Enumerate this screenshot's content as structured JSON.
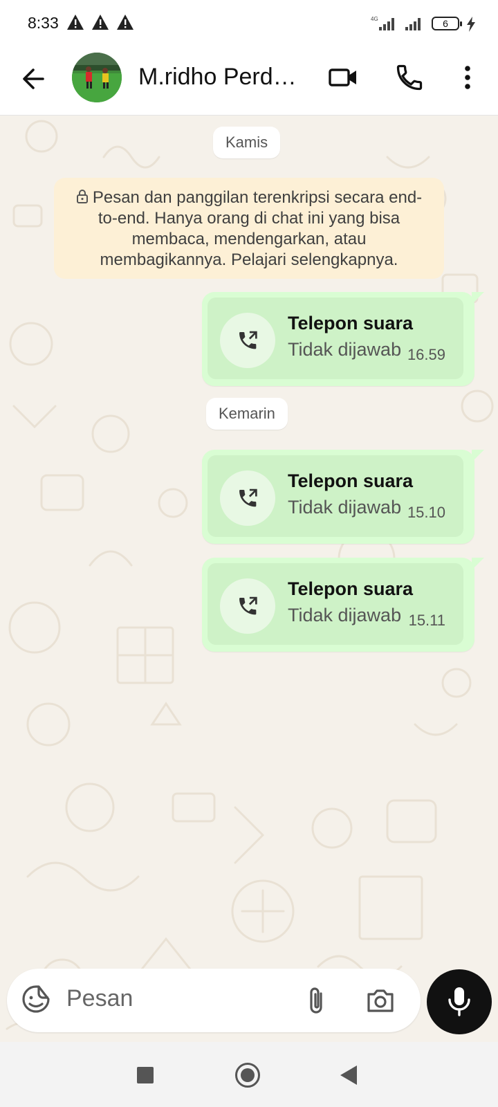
{
  "status_bar": {
    "time": "8:33",
    "network": "4G",
    "battery": "6"
  },
  "header": {
    "contact_name": "M.ridho Perdana"
  },
  "chat": {
    "date_chips": [
      "Kamis",
      "Kemarin"
    ],
    "encryption_notice": "Pesan dan panggilan terenkripsi secara end-to-end. Hanya orang di chat ini yang bisa membaca, mendengarkan, atau membagikannya. Pelajari selengkapnya.",
    "messages": [
      {
        "title": "Telepon suara",
        "status": "Tidak dijawab",
        "time": "16.59"
      },
      {
        "title": "Telepon suara",
        "status": "Tidak dijawab",
        "time": "15.10"
      },
      {
        "title": "Telepon suara",
        "status": "Tidak dijawab",
        "time": "15.11"
      }
    ]
  },
  "composer": {
    "placeholder": "Pesan"
  },
  "colors": {
    "outgoing_bubble": "#d9fdd3",
    "notice_bg": "#fdf0d6",
    "chat_bg": "#f5f1ea",
    "mic_button": "#111111"
  },
  "icons": [
    "back-arrow-icon",
    "video-call-icon",
    "phone-icon",
    "more-vert-icon",
    "outgoing-call-icon",
    "lock-icon",
    "sticker-icon",
    "paperclip-icon",
    "camera-icon",
    "mic-icon",
    "warning-icon"
  ]
}
